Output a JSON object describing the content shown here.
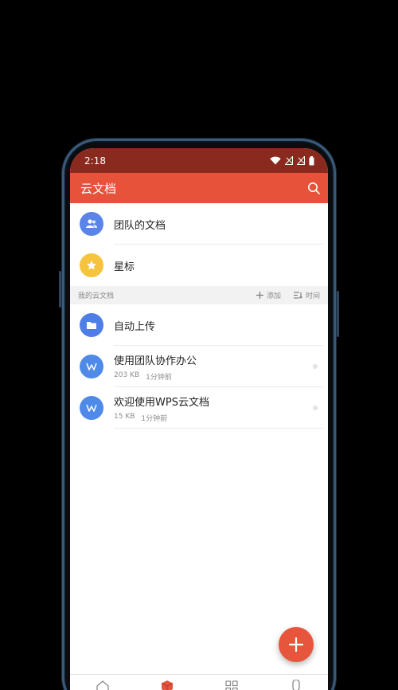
{
  "status_bar": {
    "time": "2:18"
  },
  "app_bar": {
    "title": "云文档"
  },
  "top_items": [
    {
      "label": "团队的文档",
      "icon": "team-icon",
      "color": "#5b84e8"
    },
    {
      "label": "星标",
      "icon": "star-icon",
      "color": "#f6c33f"
    }
  ],
  "section": {
    "title": "我的云文档",
    "add_label": "添加",
    "sort_label": "时间"
  },
  "files": [
    {
      "name": "自动上传",
      "icon": "folder-icon",
      "color": "#4f7fe6",
      "size": "",
      "time": ""
    },
    {
      "name": "使用团队协作办公",
      "icon": "wps-doc-icon",
      "color": "#4f8ae9",
      "size": "203 KB",
      "time": "1分钟前"
    },
    {
      "name": "欢迎使用WPS云文档",
      "icon": "wps-doc-icon",
      "color": "#4f8ae9",
      "size": "15 KB",
      "time": "1分钟前"
    }
  ],
  "colors": {
    "status_bar": "#8a2a1f",
    "app_bar": "#e6523a",
    "fab": "#e8553d"
  }
}
